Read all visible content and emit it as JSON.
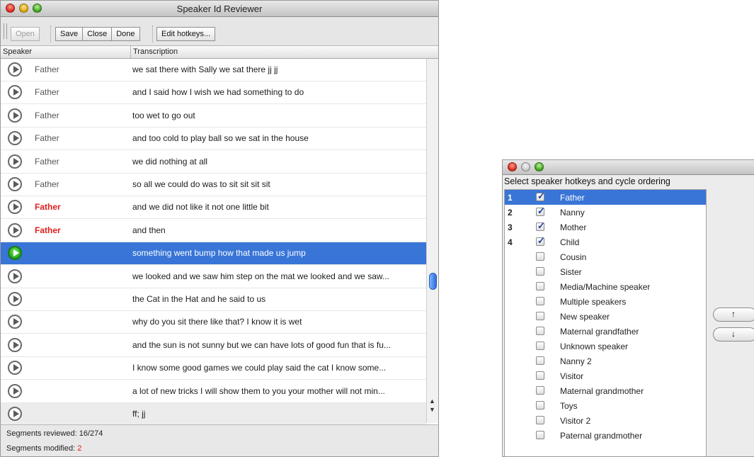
{
  "main_window": {
    "title": "Speaker Id Reviewer",
    "toolbar": {
      "open_label": "Open",
      "save_label": "Save",
      "close_label": "Close",
      "done_label": "Done",
      "edit_hotkeys_label": "Edit hotkeys..."
    },
    "columns": {
      "speaker": "Speaker",
      "transcription": "Transcription"
    },
    "rows": [
      {
        "speaker": "Father",
        "text": "we sat there with Sally we sat there jj jj",
        "modified": false
      },
      {
        "speaker": "Father",
        "text": "and I said how I wish we had something to do",
        "modified": false
      },
      {
        "speaker": "Father",
        "text": "too wet to go out",
        "modified": false
      },
      {
        "speaker": "Father",
        "text": "and too cold to play ball so we sat in the house",
        "modified": false
      },
      {
        "speaker": "Father",
        "text": "we did nothing at all",
        "modified": false
      },
      {
        "speaker": "Father",
        "text": "so all we could do was to sit sit sit sit",
        "modified": false
      },
      {
        "speaker": "Father",
        "text": "and we did not like it not one little bit",
        "modified": true
      },
      {
        "speaker": "Father",
        "text": "and then",
        "modified": true
      },
      {
        "speaker": "",
        "text": "something went bump how that made us jump",
        "modified": false,
        "selected": true
      },
      {
        "speaker": "",
        "text": "we looked and we saw him step on the mat we looked and we saw...",
        "modified": false
      },
      {
        "speaker": "",
        "text": "the Cat in the Hat and he said to us",
        "modified": false
      },
      {
        "speaker": "",
        "text": "why do you sit there like that? I know it is wet",
        "modified": false
      },
      {
        "speaker": "",
        "text": "and the sun is not sunny but we can have lots of good fun that is fu...",
        "modified": false
      },
      {
        "speaker": "",
        "text": "I know some good games we could play said the cat I know some...",
        "modified": false
      },
      {
        "speaker": "",
        "text": "a lot of new tricks I will show them to you your mother will not min...",
        "modified": false
      },
      {
        "speaker": "",
        "text": "ff; jj",
        "modified": false
      }
    ],
    "status": {
      "reviewed_label": "Segments reviewed:",
      "reviewed_value": "16/274",
      "modified_label": "Segments modified:",
      "modified_value": "2"
    }
  },
  "hotkey_window": {
    "prompt": "Select speaker hotkeys and cycle ordering",
    "items": [
      {
        "key": "1",
        "label": "Father",
        "checked": true,
        "selected": true
      },
      {
        "key": "2",
        "label": "Nanny",
        "checked": true
      },
      {
        "key": "3",
        "label": "Mother",
        "checked": true
      },
      {
        "key": "4",
        "label": "Child",
        "checked": true
      },
      {
        "key": "",
        "label": "Cousin",
        "checked": false
      },
      {
        "key": "",
        "label": "Sister",
        "checked": false
      },
      {
        "key": "",
        "label": "Media/Machine speaker",
        "checked": false
      },
      {
        "key": "",
        "label": "Multiple speakers",
        "checked": false
      },
      {
        "key": "",
        "label": "New speaker",
        "checked": false
      },
      {
        "key": "",
        "label": "Maternal grandfather",
        "checked": false
      },
      {
        "key": "",
        "label": "Unknown speaker",
        "checked": false
      },
      {
        "key": "",
        "label": "Nanny 2",
        "checked": false
      },
      {
        "key": "",
        "label": "Visitor",
        "checked": false
      },
      {
        "key": "",
        "label": "Maternal grandmother",
        "checked": false
      },
      {
        "key": "",
        "label": "Toys",
        "checked": false
      },
      {
        "key": "",
        "label": "Visitor 2",
        "checked": false
      },
      {
        "key": "",
        "label": "Paternal grandmother",
        "checked": false
      }
    ],
    "move_up_glyph": "↑",
    "move_down_glyph": "↓"
  },
  "colors": {
    "selection": "#3875d7",
    "modified": "#e0201b",
    "active_play": "#1ea01e"
  }
}
